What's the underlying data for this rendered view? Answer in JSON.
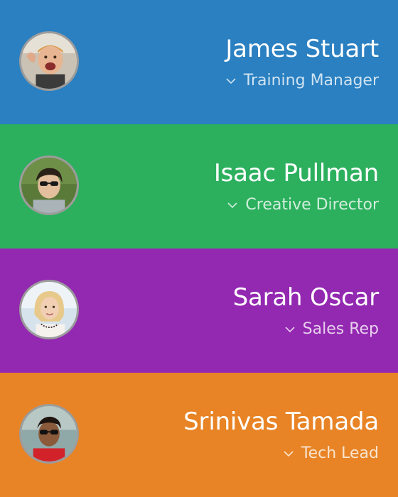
{
  "people": [
    {
      "name": "James Stuart",
      "role": "Training Manager",
      "color": "#2A80C1",
      "avatar": "avatar-photo"
    },
    {
      "name": "Isaac Pullman",
      "role": "Creative Director",
      "color": "#2CB05E",
      "avatar": "avatar-photo"
    },
    {
      "name": "Sarah Oscar",
      "role": "Sales Rep",
      "color": "#9328B1",
      "avatar": "avatar-photo"
    },
    {
      "name": "Srinivas Tamada",
      "role": "Tech Lead",
      "color": "#E88425",
      "avatar": "avatar-photo"
    }
  ],
  "icons": {
    "expand": "chevron-down-icon"
  }
}
